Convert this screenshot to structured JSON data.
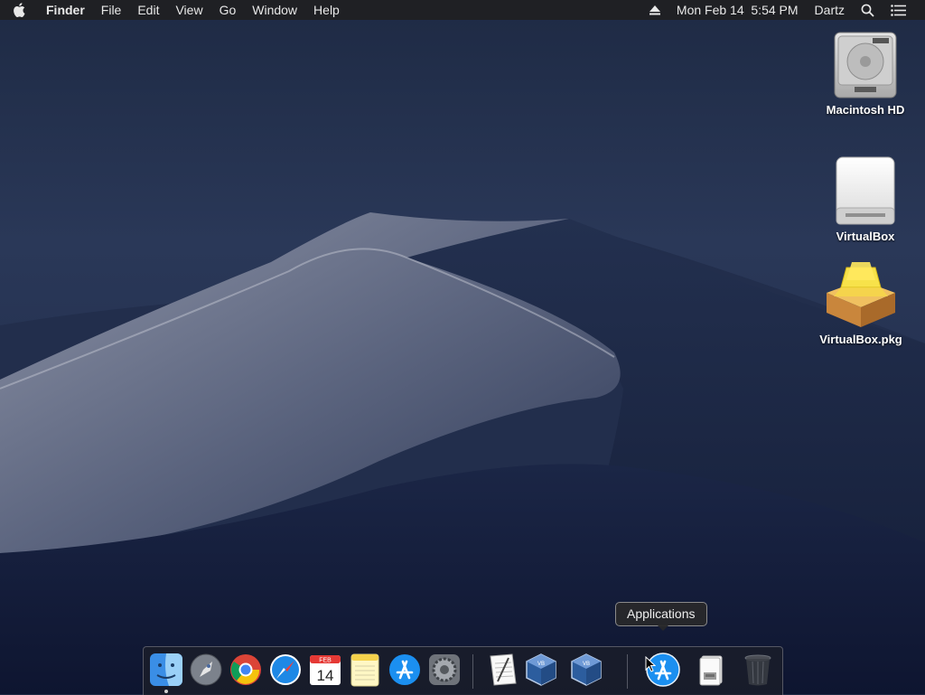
{
  "menubar": {
    "apple_icon": "apple-logo-icon",
    "app_name": "Finder",
    "menus": [
      "File",
      "Edit",
      "View",
      "Go",
      "Window",
      "Help"
    ],
    "eject_icon": "eject-icon",
    "datetime": "Mon Feb 14  5:54 PM",
    "user": "Dartz",
    "search_icon": "spotlight-search-icon",
    "notifications_icon": "notification-center-icon"
  },
  "desktop": {
    "icons": [
      {
        "label": "Macintosh HD",
        "icon": "hard-drive-icon"
      },
      {
        "label": "VirtualBox",
        "icon": "external-disk-icon"
      },
      {
        "label": "VirtualBox.pkg",
        "icon": "package-icon"
      }
    ]
  },
  "tooltip": {
    "text": "Applications"
  },
  "dock": {
    "items": [
      {
        "name": "Finder",
        "icon": "finder-icon",
        "running": true
      },
      {
        "name": "Launchpad",
        "icon": "launchpad-icon"
      },
      {
        "name": "Google Chrome",
        "icon": "chrome-icon"
      },
      {
        "name": "Safari",
        "icon": "safari-icon"
      },
      {
        "name": "Calendar",
        "icon": "calendar-icon",
        "month": "FEB",
        "day": "14"
      },
      {
        "name": "Notes",
        "icon": "notes-icon"
      },
      {
        "name": "App Store",
        "icon": "app-store-icon"
      },
      {
        "name": "System Preferences",
        "icon": "system-preferences-icon"
      },
      {
        "name": "TextEdit",
        "icon": "textedit-icon"
      },
      {
        "name": "VirtualBox",
        "icon": "virtualbox-icon"
      },
      {
        "name": "VirtualBox",
        "icon": "virtualbox-icon"
      },
      {
        "name": "Applications",
        "icon": "applications-folder-icon"
      },
      {
        "name": "Downloads",
        "icon": "downloads-stack-icon"
      },
      {
        "name": "Trash",
        "icon": "trash-icon"
      }
    ]
  }
}
